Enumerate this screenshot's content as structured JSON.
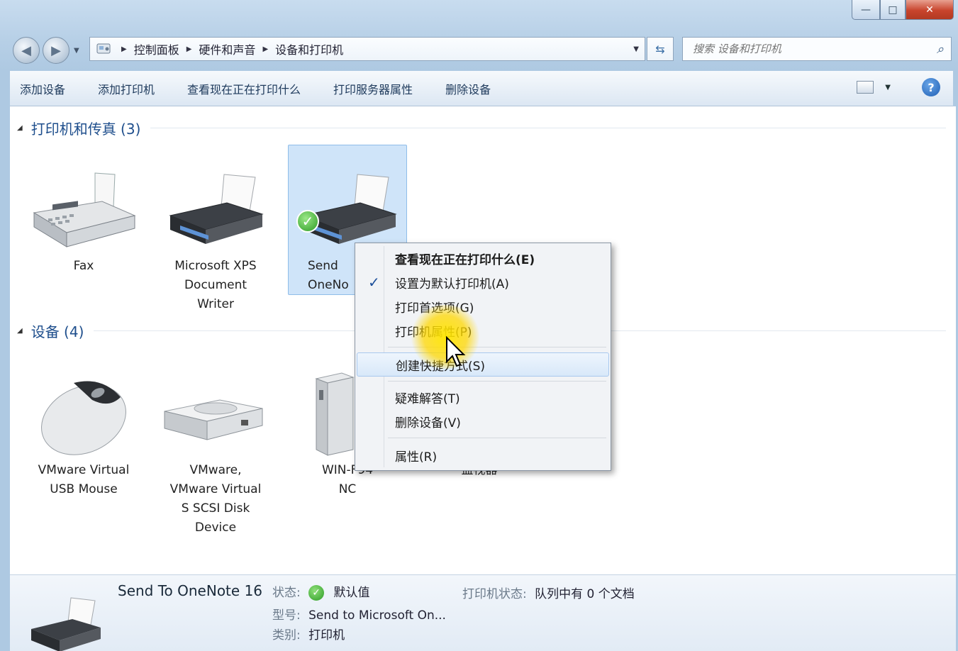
{
  "window": {
    "caption": {
      "min": "—",
      "max": "□",
      "close": "✕"
    }
  },
  "nav": {
    "back": "◀",
    "forward": "▶",
    "breadcrumbs": [
      "控制面板",
      "硬件和声音",
      "设备和打印机"
    ],
    "search_placeholder": "搜索 设备和打印机"
  },
  "toolbar": {
    "items": [
      "添加设备",
      "添加打印机",
      "查看现在正在打印什么",
      "打印服务器属性",
      "删除设备"
    ],
    "help": "?"
  },
  "groups": {
    "printers": {
      "title": "打印机和传真 (3)"
    },
    "devices": {
      "title": "设备 (4)"
    }
  },
  "printers": [
    {
      "label": "Fax",
      "icon": "fax-icon"
    },
    {
      "label": "Microsoft XPS\nDocument\nWriter",
      "icon": "printer-icon"
    },
    {
      "label": "Send\nOneNo",
      "icon": "printer-icon",
      "default": true
    }
  ],
  "devices": [
    {
      "label": "VMware Virtual\nUSB Mouse",
      "icon": "mouse-icon"
    },
    {
      "label": "VMware,\nVMware Virtual\nS SCSI Disk\nDevice",
      "icon": "disk-icon"
    },
    {
      "label": "WIN-F94\nNC",
      "icon": "computer-icon"
    },
    {
      "label": "监视器",
      "icon": "monitor-icon"
    }
  ],
  "context_menu": {
    "items": [
      {
        "label": "查看现在正在打印什么(E)",
        "bold": true
      },
      {
        "label": "设置为默认打印机(A)",
        "checked": true,
        "check": "✓"
      },
      {
        "label": "打印首选项(G)"
      },
      {
        "label": "打印机属性(P)"
      },
      {
        "label": "创建快捷方式(S)",
        "highlighted": true
      },
      {
        "label": "疑难解答(T)"
      },
      {
        "label": "删除设备(V)"
      },
      {
        "label": "属性(R)"
      }
    ]
  },
  "details": {
    "name": "Send To OneNote 16",
    "status_key": "状态:",
    "status_value": "默认值",
    "model_key": "型号:",
    "model_value": "Send to Microsoft On...",
    "category_key": "类别:",
    "category_value": "打印机",
    "printer_status_key": "打印机状态:",
    "printer_status_value": "队列中有 0 个文档"
  },
  "colors": {
    "accent": "#1e4e8c",
    "selection": "#cfe4f9",
    "status_ok": "#2d9b25"
  }
}
